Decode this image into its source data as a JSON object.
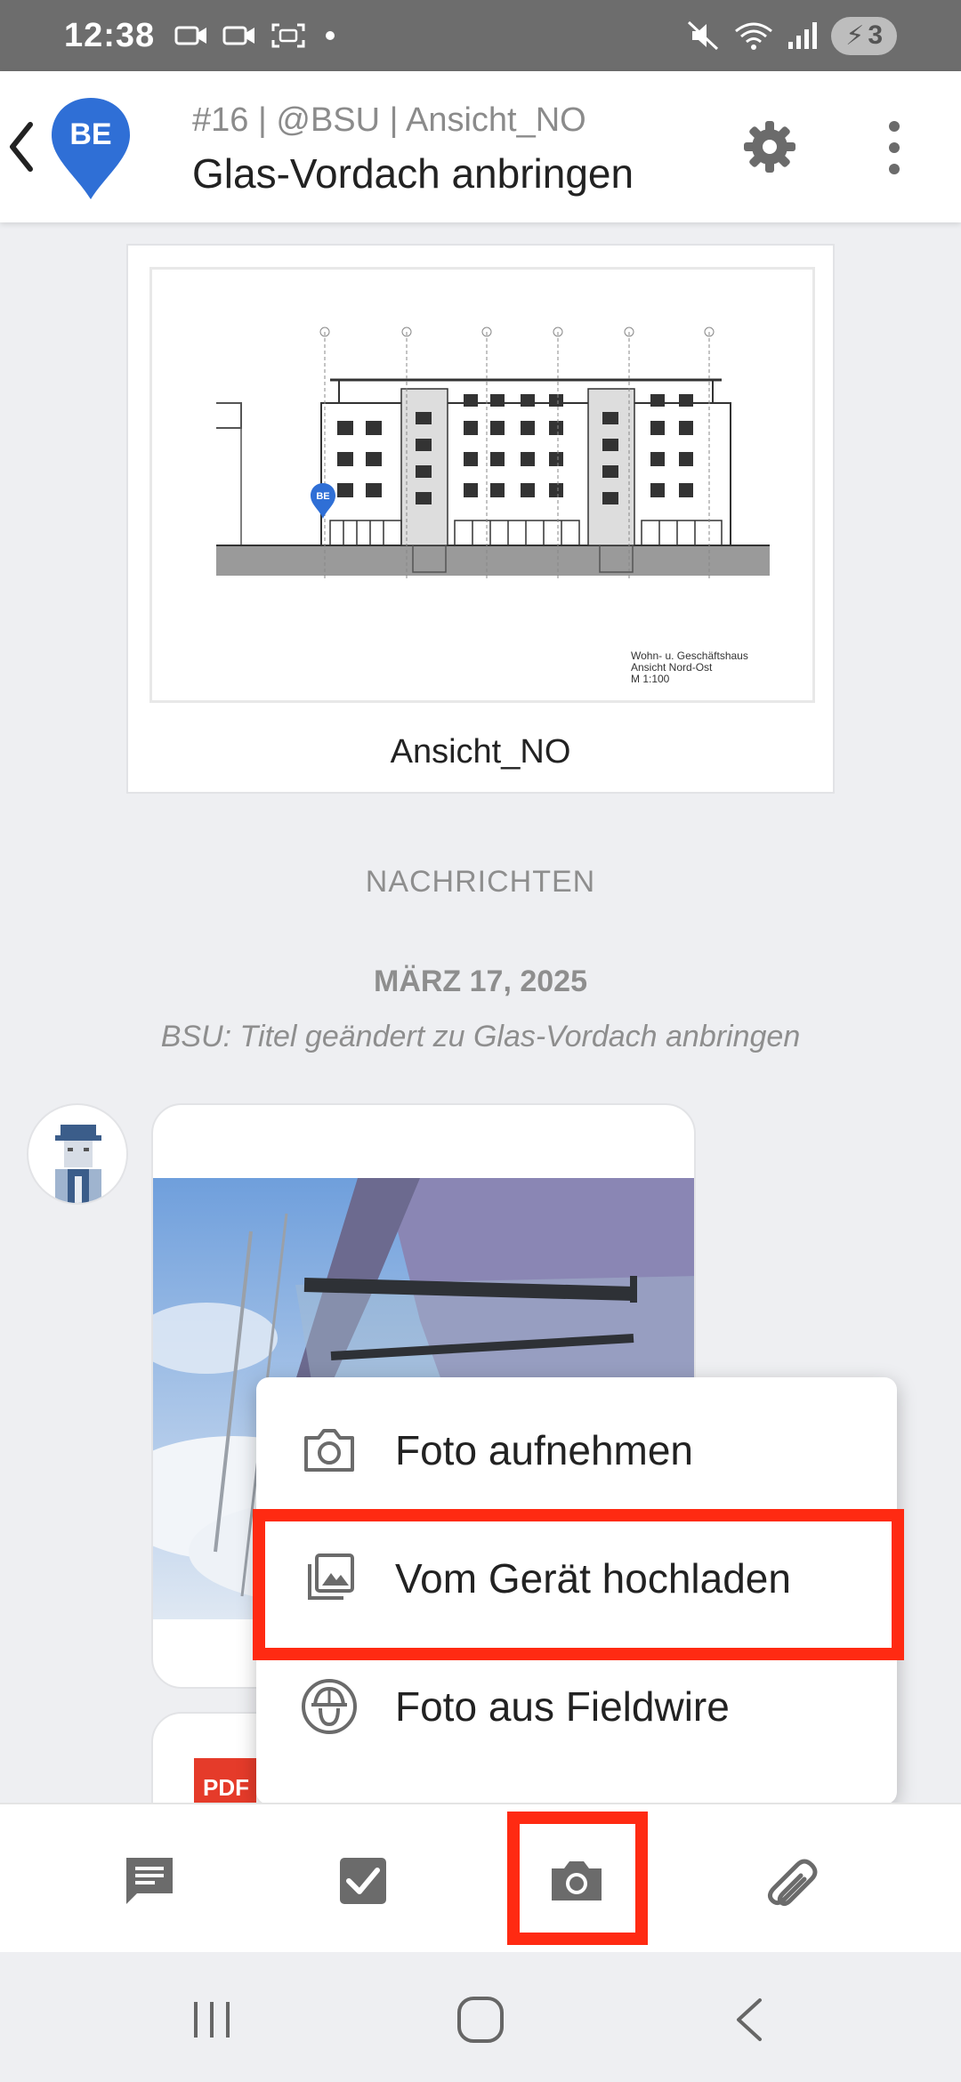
{
  "status_bar": {
    "time": "12:38",
    "battery": "3"
  },
  "header": {
    "subtitle": "#16 | @BSU | Ansicht_NO",
    "title": "Glas-Vordach anbringen",
    "marker_initials": "BE"
  },
  "plan": {
    "caption": "Ansicht_NO",
    "marker_initials": "BE",
    "title_block": [
      "Wohn- u. Geschäftshaus",
      "Ansicht Nord-Ost",
      "M 1:100"
    ]
  },
  "messages": {
    "section_label": "NACHRICHTEN",
    "date": "MÄRZ 17, 2025",
    "system_message": "BSU: Titel geändert zu Glas-Vordach anbringen",
    "pdf_label": "PDF"
  },
  "popup_menu": {
    "items": [
      {
        "label": "Foto aufnehmen",
        "icon": "camera-icon"
      },
      {
        "label": "Vom Gerät hochladen",
        "icon": "gallery-icon"
      },
      {
        "label": "Foto aus Fieldwire",
        "icon": "fieldwire-icon"
      }
    ]
  },
  "bottom_tabs": [
    {
      "icon": "chat-icon"
    },
    {
      "icon": "checkbox-icon"
    },
    {
      "icon": "camera-icon"
    },
    {
      "icon": "paperclip-icon"
    }
  ],
  "colors": {
    "accent": "#2f6fd6",
    "highlight": "#ff2a12",
    "icon_gray": "#6b6b6b",
    "pdf_red": "#e53b2a"
  }
}
